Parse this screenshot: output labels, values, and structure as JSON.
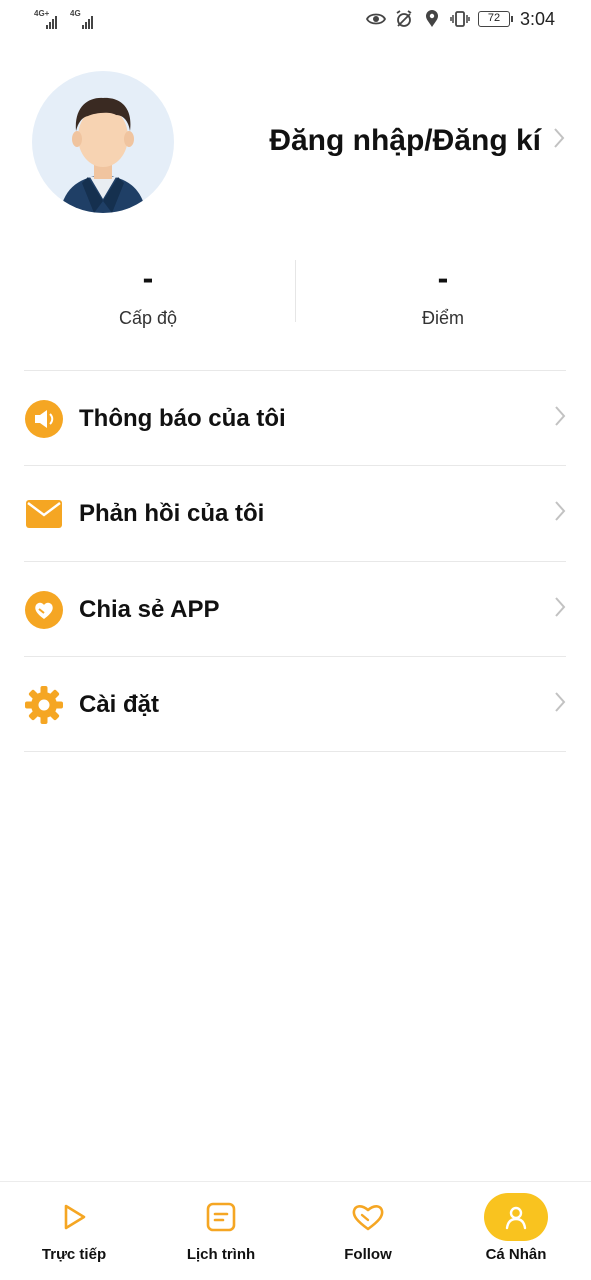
{
  "status_bar": {
    "signal1_label": "4G+",
    "signal2_label": "4G",
    "battery": "72",
    "time": "3:04"
  },
  "profile": {
    "login_label": "Đăng nhập/Đăng kí"
  },
  "stats": {
    "level": {
      "value": "-",
      "label": "Cấp độ"
    },
    "points": {
      "value": "-",
      "label": "Điểm"
    }
  },
  "menu": {
    "items": [
      {
        "label": "Thông báo của tôi",
        "icon": "speaker-icon"
      },
      {
        "label": "Phản hồi của tôi",
        "icon": "envelope-icon"
      },
      {
        "label": "Chia sẻ APP",
        "icon": "heart-share-icon"
      },
      {
        "label": "Cài đặt",
        "icon": "gear-icon"
      }
    ]
  },
  "bottom_nav": {
    "tabs": [
      {
        "label": "Trực tiếp",
        "icon": "play-icon"
      },
      {
        "label": "Lịch trình",
        "icon": "schedule-icon"
      },
      {
        "label": "Follow",
        "icon": "heart-icon"
      },
      {
        "label": "Cá Nhân",
        "icon": "person-icon",
        "active": true
      }
    ]
  },
  "colors": {
    "accent": "#f9c31f",
    "icon_orange": "#f5a623",
    "text": "#111111",
    "chevron": "#c2c2c2"
  }
}
